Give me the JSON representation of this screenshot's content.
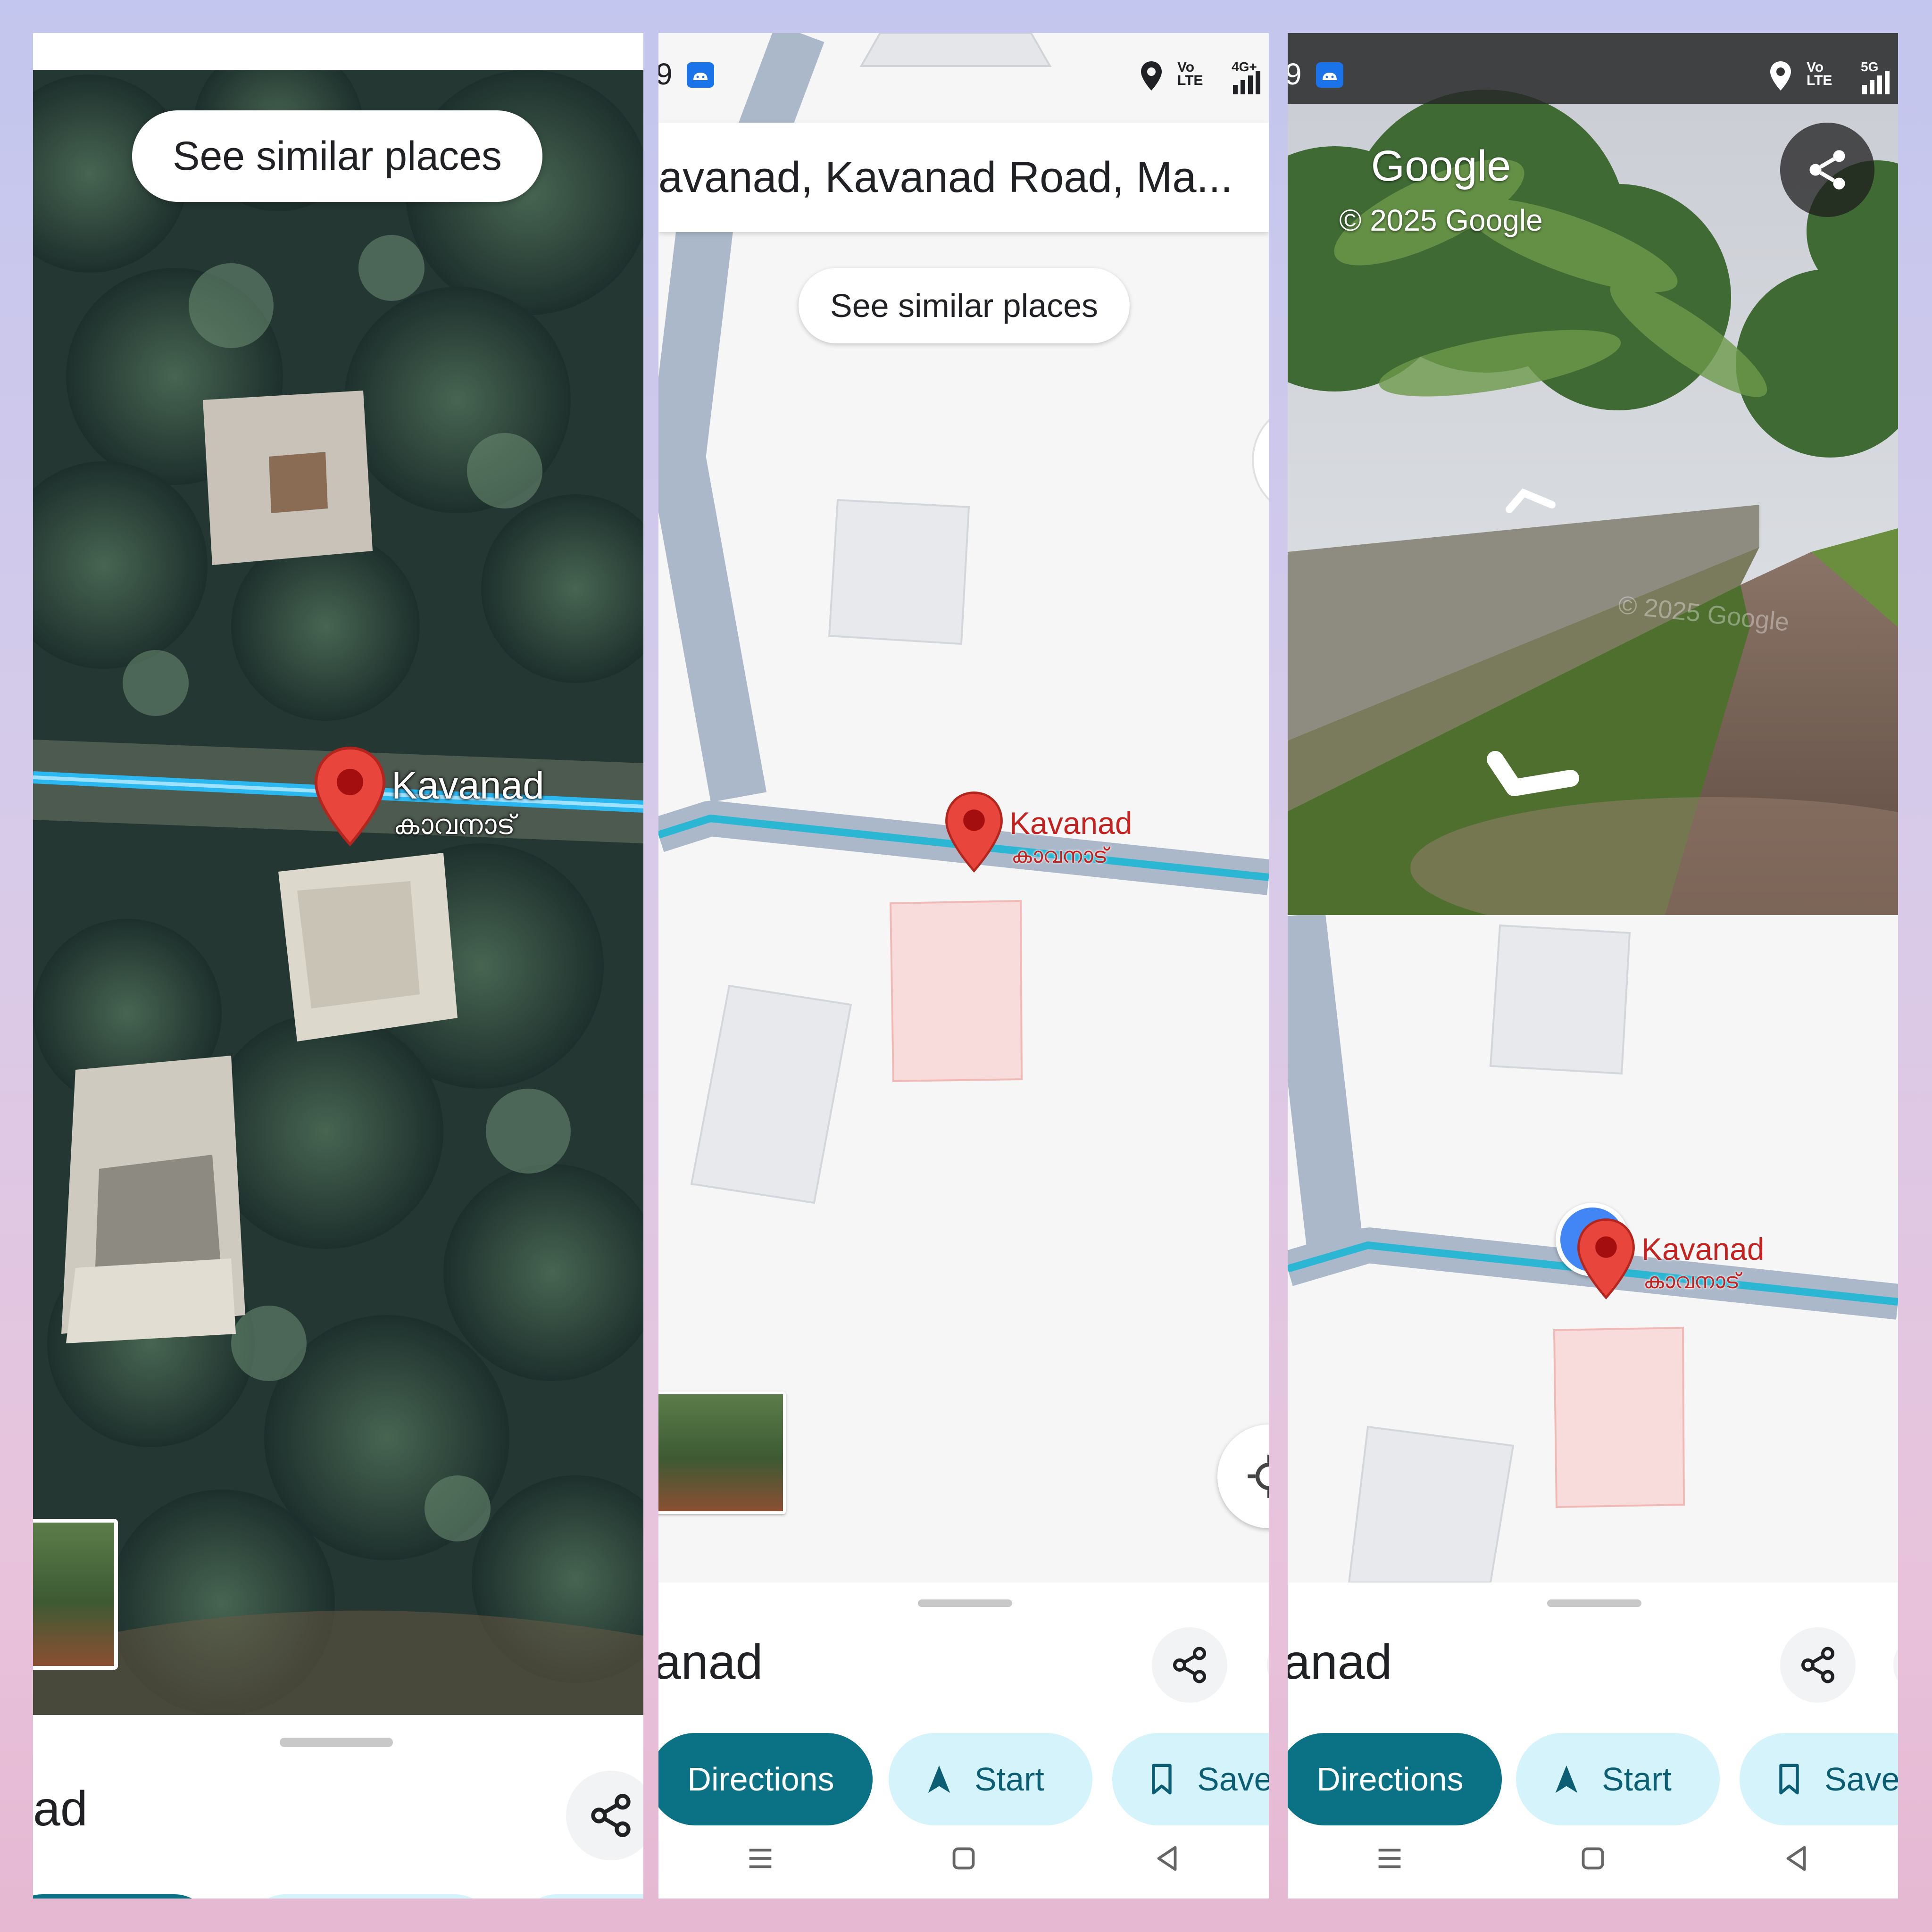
{
  "panels": [
    {
      "similar_places": "See similar places",
      "pin": {
        "name": "Kavanad",
        "name_local": "കാവനാട്"
      },
      "sheet_title": "ad"
    },
    {
      "status": {
        "left": "9",
        "vo": "Vo",
        "lte": "LTE",
        "net": "4G+"
      },
      "search_text": "avanad, Kavanad Road, Ma...",
      "similar_places": "See similar places",
      "pin": {
        "name": "Kavanad",
        "name_local": "കാവനാട്"
      },
      "sheet_title": "anad",
      "actions": {
        "directions": "Directions",
        "start": "Start",
        "save": "Save"
      }
    },
    {
      "status": {
        "left": "9",
        "vo": "Vo",
        "lte": "LTE",
        "net": "5G"
      },
      "streetview": {
        "brand": "Google",
        "copyright": "© 2025 Google",
        "watermark": "© 2025 Google"
      },
      "pin": {
        "name": "Kavanad",
        "name_local": "കാവനാട്"
      },
      "sheet_title": "anad",
      "actions": {
        "directions": "Directions",
        "start": "Start",
        "save": "Save"
      }
    }
  ],
  "colors": {
    "teal": "#0b7285",
    "chip_light": "#d5f3fb",
    "pin_red": "#e8453c",
    "route": "#2bb7d4",
    "road": "#aab8c9"
  }
}
